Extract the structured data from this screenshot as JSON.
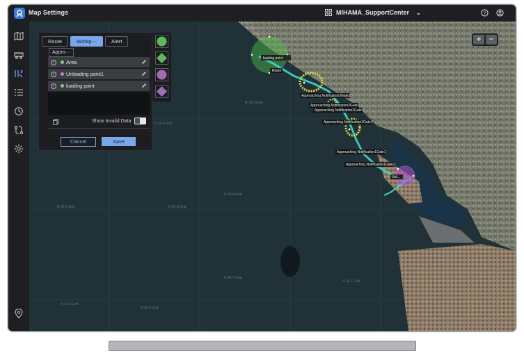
{
  "app": {
    "title": "Map Settings"
  },
  "site": {
    "name": "MIHAMA_SupportCenter"
  },
  "tabs": [
    {
      "label": "Route",
      "active": false
    },
    {
      "label": "Workp···",
      "active": true
    },
    {
      "label": "Alert",
      "active": false
    }
  ],
  "subtab": {
    "label": "Appro···"
  },
  "items": [
    {
      "label": "Area",
      "color": "#7ed07a"
    },
    {
      "label": "Unloading point1",
      "color": "#d37ae0"
    },
    {
      "label": "loading point",
      "color": "#7ed07a"
    }
  ],
  "invalid": {
    "label": "Show Invalid Data"
  },
  "buttons": {
    "cancel": "Cancel",
    "save": "Save"
  },
  "zoom": {
    "in": "+",
    "out": "−"
  },
  "map_labels": {
    "loading_point": "loading point",
    "route": "Route",
    "gate3": "Approaching Notification3Gate1",
    "gate2": "Approaching Notification2Gate2",
    "gate2b": "Approaching Notification2Gate3",
    "gate_mid": "Approaching Notification2Gate2",
    "gate1": "Approaching Notification1Gate1",
    "gate1b": "Approaching Notification1Gate2",
    "unloading": "Unl..."
  },
  "colors": {
    "accent": "#7aa7e8",
    "route": "#3fd6c2",
    "area_green": "#4fbf4a",
    "gate_yellow": "#e3d84a",
    "unload_purple": "#b24fc7"
  }
}
